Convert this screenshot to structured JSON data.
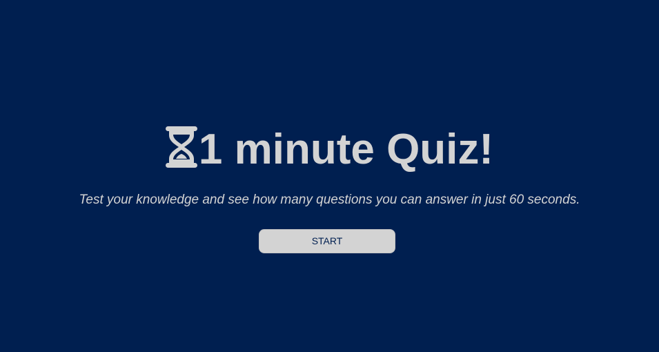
{
  "colors": {
    "background": "#001f50",
    "text": "#d3d3d3",
    "button_background": "#d3d3d3",
    "button_text": "#001f50"
  },
  "intro": {
    "icon": "hourglass-icon",
    "title": "1 minute Quiz!",
    "subtitle": "Test your knowledge and see how many questions you can answer in just 60 seconds.",
    "start_label": "START"
  }
}
